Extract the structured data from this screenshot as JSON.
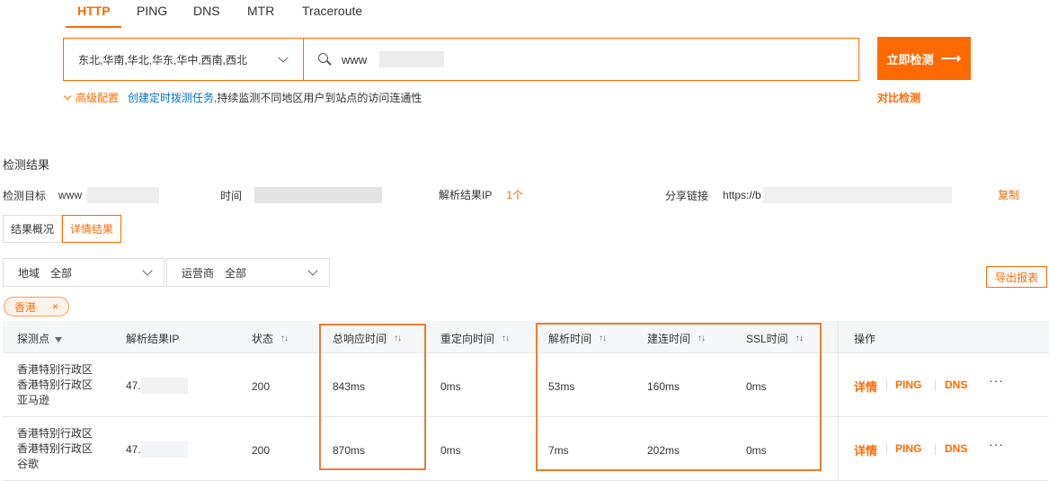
{
  "tabs": [
    "HTTP",
    "PING",
    "DNS",
    "MTR",
    "Traceroute"
  ],
  "region_select": "东北,华南,华北,华东,华中,西南,西北",
  "url_input": "www",
  "start_button": "立即检测",
  "start_arrow": "⟶",
  "advanced_config": "高级配置",
  "create_schedule": "创建定时拨测任务",
  "schedule_desc": ",持续监测不同地区用户到站点的访问连通性",
  "compare_check": "对比检测",
  "results_title": "检测结果",
  "info": {
    "target_label": "检测目标",
    "target_value": "www",
    "time_label": "时间",
    "ip_label": "解析结果IP",
    "ip_count": "1个",
    "share_label": "分享链接",
    "share_value": "https://b",
    "copy": "复制"
  },
  "view_tabs": [
    "结果概况",
    "详情结果"
  ],
  "filters": {
    "region_label": "地域",
    "region_value": "全部",
    "isp_label": "运营商",
    "isp_value": "全部"
  },
  "export_button": "导出报表",
  "chip_label": "香港",
  "chip_close": "×",
  "columns": {
    "probe": "探测点",
    "ip": "解析结果IP",
    "status": "状态",
    "total": "总响应时间",
    "redirect": "重定向时间",
    "resolve": "解析时间",
    "connect": "建连时间",
    "ssl": "SSL时间",
    "ops": "操作"
  },
  "sort_glyph": "↑↓",
  "rows": [
    {
      "probe_line1": "香港特别行政区",
      "probe_line2": "香港特别行政区",
      "probe_line3": "亚马逊",
      "ip": "47.",
      "status": "200",
      "total": "843ms",
      "redirect": "0ms",
      "resolve": "53ms",
      "connect": "160ms",
      "ssl": "0ms"
    },
    {
      "probe_line1": "香港特别行政区",
      "probe_line2": "香港特别行政区",
      "probe_line3": "谷歌",
      "ip": "47.",
      "status": "200",
      "total": "870ms",
      "redirect": "0ms",
      "resolve": "7ms",
      "connect": "202ms",
      "ssl": "0ms"
    }
  ],
  "actions": {
    "detail": "详情",
    "ping": "PING",
    "dns": "DNS",
    "more": "···"
  }
}
